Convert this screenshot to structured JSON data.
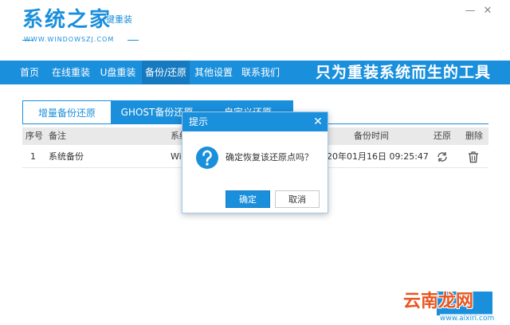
{
  "header": {
    "logo_title": "系统之家",
    "logo_slogan": "一键重装",
    "logo_url": "WWW.WINDOWSZJ.COM",
    "minimize_glyph": "—",
    "close_glyph": "✕"
  },
  "nav": {
    "items": [
      {
        "label": "首页"
      },
      {
        "label": "在线重装"
      },
      {
        "label": "U盘重装"
      },
      {
        "label": "备份/还原",
        "active": true
      },
      {
        "label": "其他设置"
      },
      {
        "label": "联系我们"
      }
    ],
    "slogan": "只为重装系统而生的工具"
  },
  "tabs": [
    {
      "label": "增量备份还原",
      "active": true
    },
    {
      "label": "GHOST备份还原"
    },
    {
      "label": "自定义还原"
    }
  ],
  "table": {
    "columns": {
      "index": "序号",
      "note": "备注",
      "system": "系统",
      "time": "备份时间",
      "restore": "还原",
      "delete": "删除"
    },
    "rows": [
      {
        "index": "1",
        "note": "系统备份",
        "system": "Wi",
        "time": "20年01月16日 09:25:47"
      }
    ]
  },
  "dialog": {
    "title": "提示",
    "close_glyph": "✕",
    "message": "确定恢复该还原点吗？",
    "confirm_label": "确定",
    "cancel_label": "取消"
  },
  "watermark": {
    "text": "云南龙网",
    "url": "www.aixiri.com"
  },
  "colors": {
    "accent": "#1a8fdc",
    "nav_active": "#157ac0",
    "watermark": "#e8551f"
  }
}
